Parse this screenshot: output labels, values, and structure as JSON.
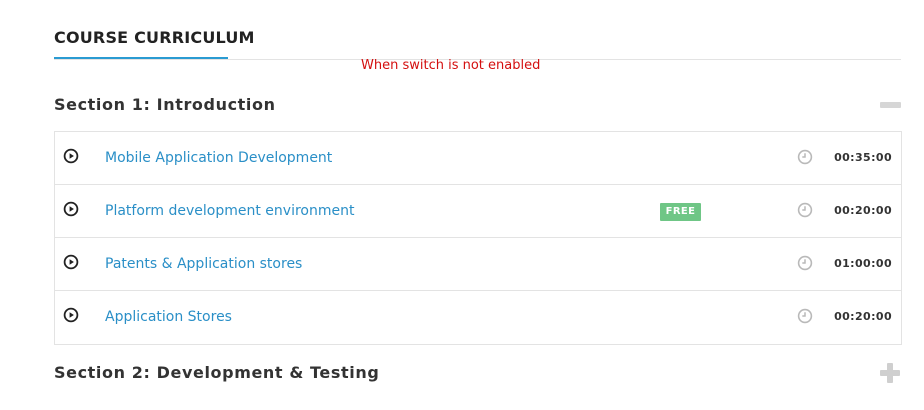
{
  "curriculum": {
    "tab_title": "COURSE CURRICULUM",
    "note": "When switch is not enabled",
    "accent_color": "#2a9bd2",
    "sections": [
      {
        "title": "Section 1: Introduction",
        "state_icon": "minus-icon",
        "lessons": [
          {
            "title": "Mobile Application Development",
            "badge": "",
            "duration": "00:35:00"
          },
          {
            "title": "Platform development environment",
            "badge": "FREE",
            "duration": "00:20:00"
          },
          {
            "title": "Patents & Application stores",
            "badge": "",
            "duration": "01:00:00"
          },
          {
            "title": "Application Stores",
            "badge": "",
            "duration": "00:20:00"
          }
        ]
      },
      {
        "title": "Section 2: Development & Testing",
        "state_icon": "plus-icon"
      }
    ]
  }
}
